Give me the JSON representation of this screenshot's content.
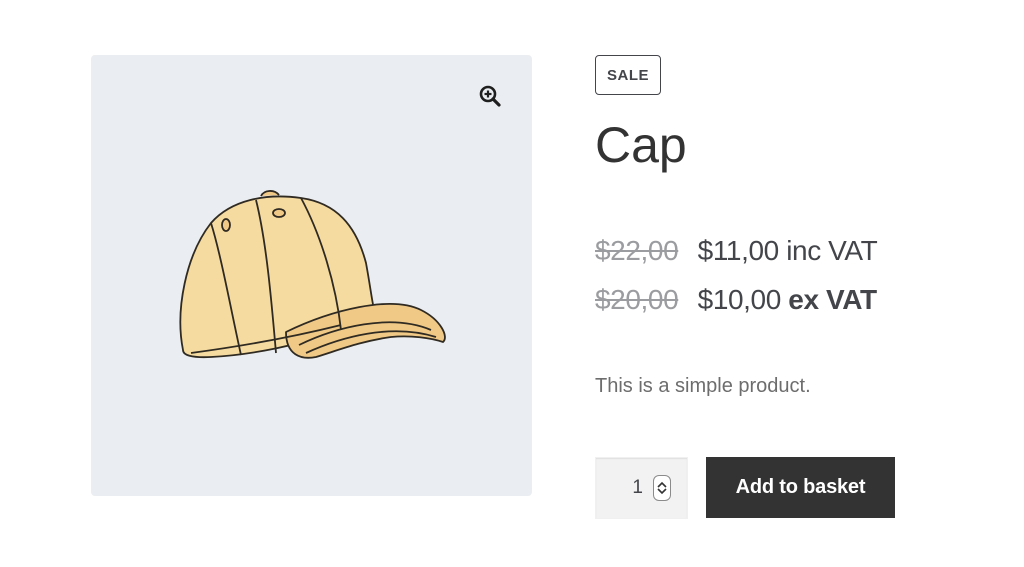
{
  "product": {
    "badge": "SALE",
    "title": "Cap",
    "prices": [
      {
        "old": "$22,00",
        "current": "$11,00",
        "suffix": "inc VAT"
      },
      {
        "old": "$20,00",
        "current": "$10,00",
        "suffix": "ex VAT"
      }
    ],
    "description": "This is a simple product.",
    "quantity": "1",
    "add_to_basket": "Add to basket"
  },
  "gallery": {
    "zoom_icon": "zoom-in-icon",
    "image": "yellow-baseball-cap-illustration"
  },
  "colors": {
    "gallery_bg": "#eaedf1",
    "button_bg": "#333333",
    "text": "#43454b",
    "old_price": "#9b9c9f"
  }
}
